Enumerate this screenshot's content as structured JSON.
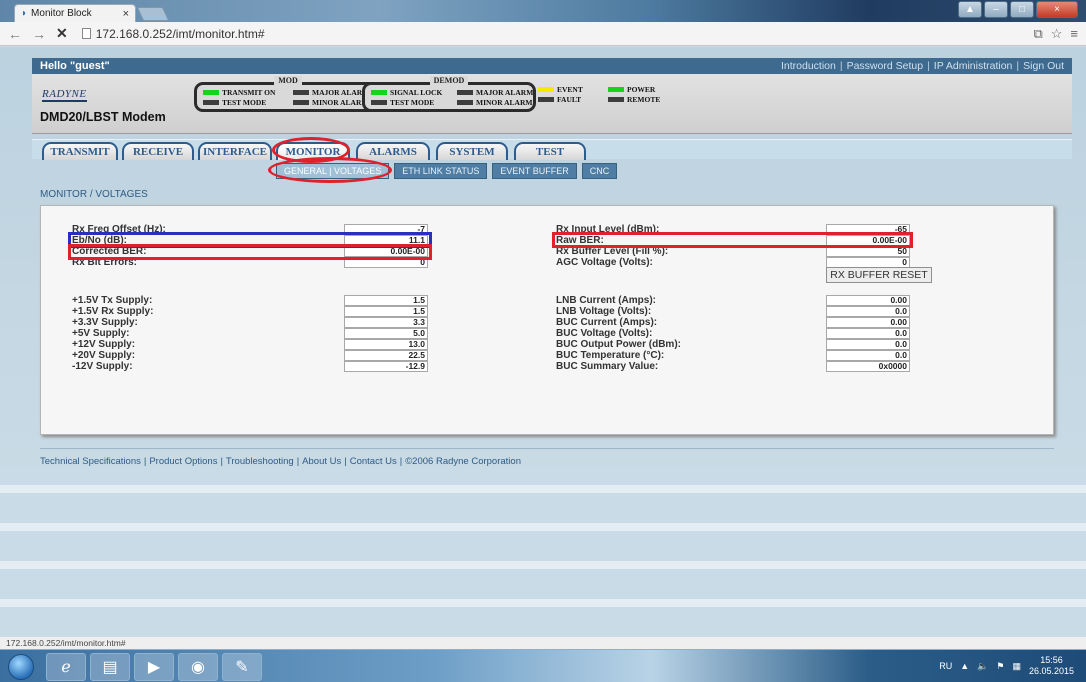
{
  "browser": {
    "tab_title": "Monitor Block",
    "url": "172.168.0.252/imt/monitor.htm#",
    "status_url": "172.168.0.252/imt/monitor.htm#"
  },
  "topbar": {
    "greeting": "Hello \"guest\"",
    "links": [
      "Introduction",
      "Password Setup",
      "IP Administration",
      "Sign Out"
    ]
  },
  "header": {
    "logo": "RADYNE",
    "model": "DMD20/LBST Modem",
    "mod": {
      "title": "MOD",
      "lamps": [
        {
          "label": "TRANSMIT ON",
          "color": "#19d219"
        },
        {
          "label": "MAJOR ALARM",
          "color": "#3d3d3d"
        },
        {
          "label": "TEST MODE",
          "color": "#3d3d3d"
        },
        {
          "label": "MINOR ALARM",
          "color": "#3d3d3d"
        }
      ]
    },
    "demod": {
      "title": "DEMOD",
      "lamps": [
        {
          "label": "SIGNAL LOCK",
          "color": "#19d219"
        },
        {
          "label": "MAJOR ALARM",
          "color": "#3d3d3d"
        },
        {
          "label": "TEST MODE",
          "color": "#3d3d3d"
        },
        {
          "label": "MINOR ALARM",
          "color": "#3d3d3d"
        }
      ]
    },
    "general_lamps": [
      {
        "label": "EVENT",
        "color": "#f3ea00"
      },
      {
        "label": "POWER",
        "color": "#19d219"
      },
      {
        "label": "FAULT",
        "color": "#3d3d3d"
      },
      {
        "label": "REMOTE",
        "color": "#3d3d3d"
      }
    ]
  },
  "nav": {
    "tabs": [
      "TRANSMIT",
      "RECEIVE",
      "INTERFACE",
      "MONITOR",
      "ALARMS",
      "SYSTEM",
      "TEST"
    ],
    "active": "MONITOR",
    "subtabs": [
      "GENERAL | VOLTAGES",
      "ETH LINK STATUS",
      "EVENT BUFFER",
      "CNC"
    ]
  },
  "section_title": "MONITOR / VOLTAGES",
  "left_top": [
    {
      "label": "Rx Freq Offset (Hz):",
      "value": "-7"
    },
    {
      "label": "Eb/No (dB):",
      "value": "11.1"
    },
    {
      "label": "Corrected BER:",
      "value": "0.00E-00"
    },
    {
      "label": "Rx Bit Errors:",
      "value": "0"
    }
  ],
  "right_top": [
    {
      "label": "Rx Input Level (dBm):",
      "value": "-65"
    },
    {
      "label": "Raw BER:",
      "value": "0.00E-00"
    },
    {
      "label": "Rx Buffer Level (Fill %):",
      "value": "50"
    },
    {
      "label": "AGC Voltage (Volts):",
      "value": "0"
    }
  ],
  "rx_buffer_reset": "RX BUFFER RESET",
  "left_bottom": [
    {
      "label": "+1.5V Tx Supply:",
      "value": "1.5"
    },
    {
      "label": "+1.5V Rx Supply:",
      "value": "1.5"
    },
    {
      "label": "+3.3V Supply:",
      "value": "3.3"
    },
    {
      "label": "+5V Supply:",
      "value": "5.0"
    },
    {
      "label": "+12V Supply:",
      "value": "13.0"
    },
    {
      "label": "+20V Supply:",
      "value": "22.5"
    },
    {
      "label": "-12V Supply:",
      "value": "-12.9"
    }
  ],
  "right_bottom": [
    {
      "label": "LNB Current (Amps):",
      "value": "0.00"
    },
    {
      "label": "LNB Voltage (Volts):",
      "value": "0.0"
    },
    {
      "label": "BUC Current (Amps):",
      "value": "0.00"
    },
    {
      "label": "BUC Voltage (Volts):",
      "value": "0.0"
    },
    {
      "label": "BUC Output Power (dBm):",
      "value": "0.0"
    },
    {
      "label": "BUC Temperature (°C):",
      "value": "0.0"
    },
    {
      "label": "BUC Summary Value:",
      "value": "0x0000"
    }
  ],
  "footer_links": [
    "Technical Specifications",
    "Product Options",
    "Troubleshooting",
    "About Us",
    "Contact Us",
    "©2006 Radyne Corporation"
  ],
  "taskbar": {
    "lang": "RU",
    "time": "15:56",
    "date": "26.05.2015"
  }
}
